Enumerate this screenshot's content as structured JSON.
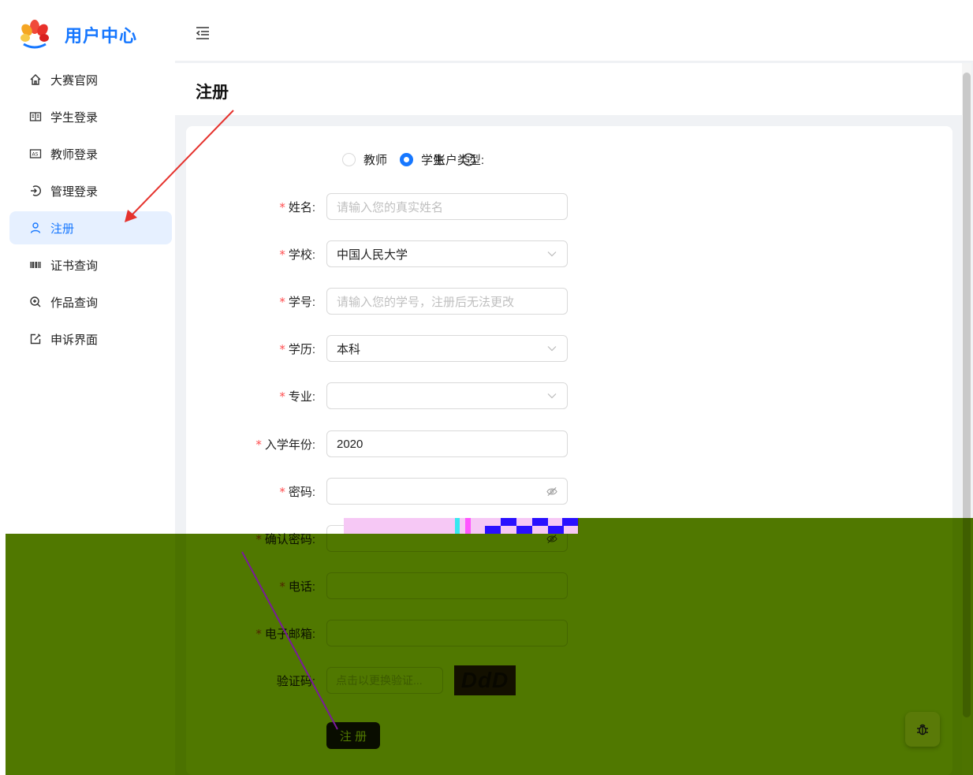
{
  "app": {
    "title": "用户中心"
  },
  "sidebar": {
    "items": [
      {
        "label": "大赛官网",
        "icon": "home-icon",
        "active": false
      },
      {
        "label": "学生登录",
        "icon": "book-icon",
        "active": false
      },
      {
        "label": "教师登录",
        "icon": "id-card-icon",
        "active": false
      },
      {
        "label": "管理登录",
        "icon": "login-icon",
        "active": false
      },
      {
        "label": "注册",
        "icon": "user-icon",
        "active": true
      },
      {
        "label": "证书查询",
        "icon": "barcode-icon",
        "active": false
      },
      {
        "label": "作品查询",
        "icon": "zoom-icon",
        "active": false
      },
      {
        "label": "申诉界面",
        "icon": "edit-icon",
        "active": false
      }
    ]
  },
  "page": {
    "title": "注册"
  },
  "form": {
    "account_type": {
      "label": "账户类型:",
      "options": [
        "教师",
        "学生"
      ],
      "selected": "学生"
    },
    "name": {
      "label": "姓名:",
      "placeholder": "请输入您的真实姓名",
      "value": ""
    },
    "school": {
      "label": "学校:",
      "value": "中国人民大学"
    },
    "student_id": {
      "label": "学号:",
      "placeholder": "请输入您的学号，注册后无法更改",
      "value": ""
    },
    "education": {
      "label": "学历:",
      "value": "本科"
    },
    "major": {
      "label": "专业:",
      "value": ""
    },
    "enroll_year": {
      "label": "入学年份:",
      "value": "2020"
    },
    "password": {
      "label": "密码:",
      "value": ""
    },
    "confirm_password": {
      "label": "确认密码:",
      "value": ""
    },
    "phone": {
      "label": "电话:",
      "value": ""
    },
    "email": {
      "label": "电子邮箱:",
      "value": ""
    },
    "captcha": {
      "label": "验证码:",
      "placeholder": "点击以更换验证...",
      "image_text": "DdD"
    },
    "submit_label": "注 册"
  },
  "colors": {
    "primary": "#1677ff",
    "required": "#ff4d4f",
    "overlay": "#507800"
  }
}
